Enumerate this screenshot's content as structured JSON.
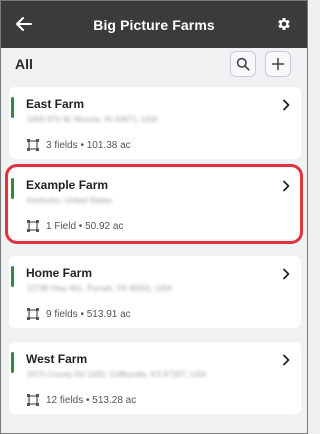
{
  "header": {
    "title": "Big Picture Farms",
    "back_icon": "arrow-left-icon",
    "settings_icon": "gear-icon"
  },
  "subheader": {
    "label": "All",
    "search_icon": "search-icon",
    "add_icon": "plus-icon"
  },
  "farms": [
    {
      "name": "East Farm",
      "address": "1900 870 W, Muncie, IN 43971, USA",
      "meta": "3 fields • 101.38 ac"
    },
    {
      "name": "Example Farm",
      "address": "Kentucky, United States",
      "meta": "1 Field • 50.92 ac"
    },
    {
      "name": "Home Farm",
      "address": "12790 Hwy 401, Purcell, TN 38201, USA",
      "meta": "9 fields • 513.91 ac"
    },
    {
      "name": "West Farm",
      "address": "2470 County Rd 1000, Coffeyville, KS 67337, USA",
      "meta": "12 fields • 513.28 ac"
    }
  ],
  "colors": {
    "appbar": "#3b3b3b",
    "accent_green": "#2e8b3a",
    "highlight_red": "#e2323e"
  }
}
